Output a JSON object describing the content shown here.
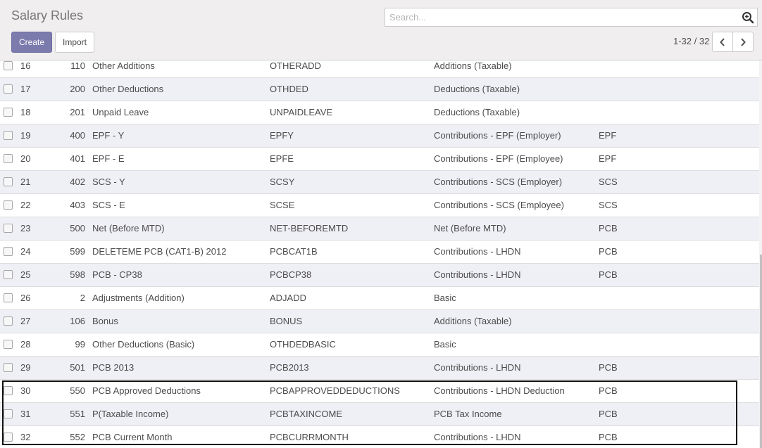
{
  "header": {
    "title": "Salary Rules",
    "search_placeholder": "Search...",
    "create_label": "Create",
    "import_label": "Import",
    "pager_value": "1-32 / 32"
  },
  "rows": [
    {
      "seq": "16",
      "code": "110",
      "name": "Other Additions",
      "ref": "OTHERADD",
      "category": "Additions (Taxable)",
      "group": ""
    },
    {
      "seq": "17",
      "code": "200",
      "name": "Other Deductions",
      "ref": "OTHDED",
      "category": "Deductions (Taxable)",
      "group": ""
    },
    {
      "seq": "18",
      "code": "201",
      "name": "Unpaid Leave",
      "ref": "UNPAIDLEAVE",
      "category": "Deductions (Taxable)",
      "group": ""
    },
    {
      "seq": "19",
      "code": "400",
      "name": "EPF - Y",
      "ref": "EPFY",
      "category": "Contributions - EPF (Employer)",
      "group": "EPF"
    },
    {
      "seq": "20",
      "code": "401",
      "name": "EPF - E",
      "ref": "EPFE",
      "category": "Contributions - EPF (Employee)",
      "group": "EPF"
    },
    {
      "seq": "21",
      "code": "402",
      "name": "SCS - Y",
      "ref": "SCSY",
      "category": "Contributions - SCS (Employer)",
      "group": "SCS"
    },
    {
      "seq": "22",
      "code": "403",
      "name": "SCS - E",
      "ref": "SCSE",
      "category": "Contributions - SCS (Employee)",
      "group": "SCS"
    },
    {
      "seq": "23",
      "code": "500",
      "name": "Net (Before MTD)",
      "ref": "NET-BEFOREMTD",
      "category": "Net (Before MTD)",
      "group": "PCB"
    },
    {
      "seq": "24",
      "code": "599",
      "name": "DELETEME PCB (CAT1-B) 2012",
      "ref": "PCBCAT1B",
      "category": "Contributions - LHDN",
      "group": "PCB"
    },
    {
      "seq": "25",
      "code": "598",
      "name": "PCB - CP38",
      "ref": "PCBCP38",
      "category": "Contributions - LHDN",
      "group": "PCB"
    },
    {
      "seq": "26",
      "code": "2",
      "name": "Adjustments (Addition)",
      "ref": "ADJADD",
      "category": "Basic",
      "group": ""
    },
    {
      "seq": "27",
      "code": "106",
      "name": "Bonus",
      "ref": "BONUS",
      "category": "Additions (Taxable)",
      "group": ""
    },
    {
      "seq": "28",
      "code": "99",
      "name": "Other Deductions (Basic)",
      "ref": "OTHDEDBASIC",
      "category": "Basic",
      "group": ""
    },
    {
      "seq": "29",
      "code": "501",
      "name": "PCB 2013",
      "ref": "PCB2013",
      "category": "Contributions - LHDN",
      "group": "PCB"
    },
    {
      "seq": "30",
      "code": "550",
      "name": "PCB Approved Deductions",
      "ref": "PCBAPPROVEDDEDUCTIONS",
      "category": "Contributions - LHDN Deduction",
      "group": "PCB"
    },
    {
      "seq": "31",
      "code": "551",
      "name": "P(Taxable Income)",
      "ref": "PCBTAXINCOME",
      "category": "PCB Tax Income",
      "group": "PCB"
    },
    {
      "seq": "32",
      "code": "552",
      "name": "PCB Current Month",
      "ref": "PCBCURRMONTH",
      "category": "Contributions - LHDN",
      "group": "PCB"
    }
  ],
  "colors": {
    "primary": "#7c7bad",
    "row_alt": "#efeff6",
    "control_panel": "#f0eeee"
  }
}
